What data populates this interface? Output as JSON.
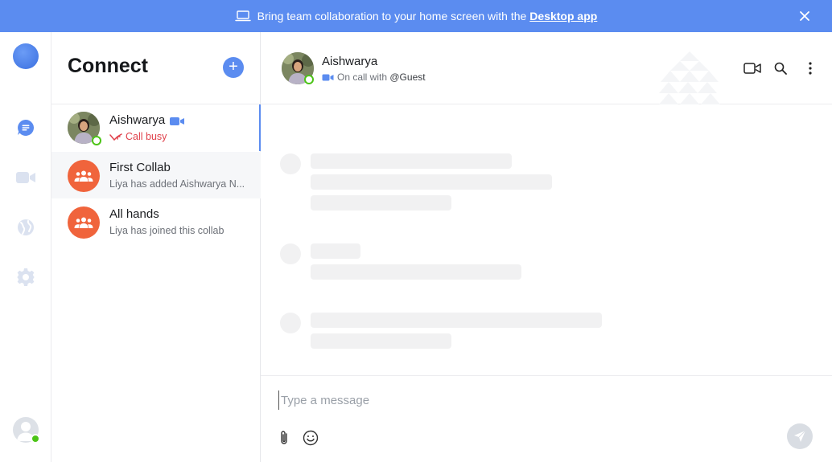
{
  "banner": {
    "text": "Bring team collaboration to your home screen with the",
    "link": "Desktop app"
  },
  "list": {
    "title": "Connect",
    "conversations": [
      {
        "name": "Aishwarya",
        "subtitle": "Call busy"
      },
      {
        "name": "First Collab",
        "subtitle": "Liya has added Aishwarya N..."
      },
      {
        "name": "All hands",
        "subtitle": "Liya has joined this collab"
      }
    ]
  },
  "chat": {
    "name": "Aishwarya",
    "status_prefix": "On call with",
    "status_user": "@Guest"
  },
  "composer": {
    "placeholder": "Type a message"
  },
  "colors": {
    "accent": "#5b8cf0",
    "group_avatar": "#f0643c",
    "online": "#4cc417",
    "busy": "#e0414b"
  }
}
